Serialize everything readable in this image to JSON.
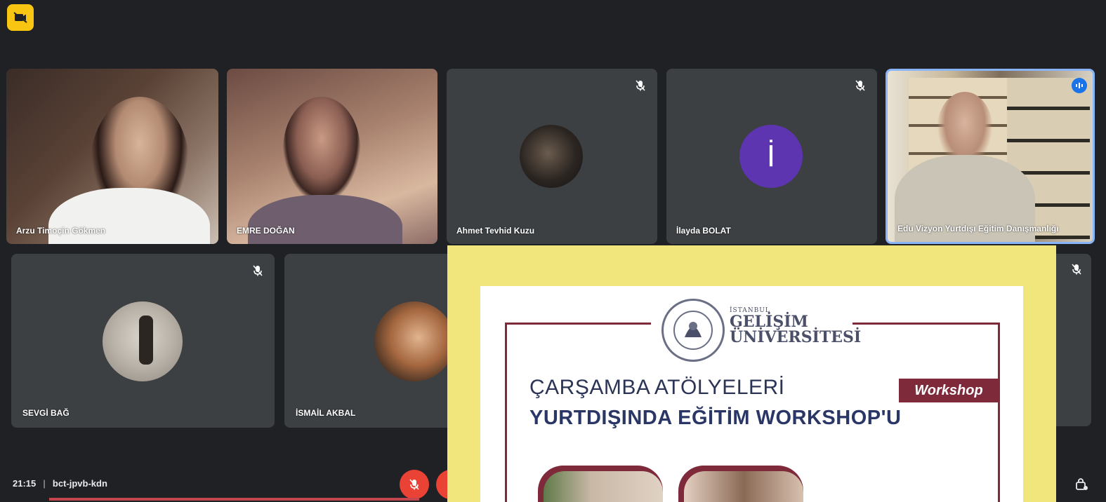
{
  "top": {
    "camera_badge_icon": "camera-off-icon",
    "badge_color": "#f9c513"
  },
  "participants_row1": [
    {
      "name": "Arzu Timoçin Gökmen",
      "type": "video",
      "muted": false
    },
    {
      "name": "EMRE DOĞAN",
      "type": "video",
      "muted": false
    },
    {
      "name": "Ahmet Tevhid Kuzu",
      "type": "avatar-photo",
      "muted": true
    },
    {
      "name": "İlayda BOLAT",
      "type": "avatar-letter",
      "letter": "İ",
      "avatar_color": "#5e35b1",
      "muted": true
    },
    {
      "name": "Edu Vizyon Yurtdışı Eğitim Danışmanlığı",
      "type": "video",
      "muted": false,
      "speaking": true
    }
  ],
  "participants_row2": [
    {
      "name": "SEVGİ BAĞ",
      "type": "avatar-photo",
      "muted": true
    },
    {
      "name": "İSMAİL AKBAL",
      "type": "avatar-photo",
      "muted": true
    }
  ],
  "bottom": {
    "time": "21:15",
    "meeting_code": "bct-jpvb-kdn"
  },
  "poster": {
    "university_small": "İSTANBUL",
    "university_line1": "GELİŞİM",
    "university_line2": "ÜNİVERSİTESİ",
    "badge": "Workshop",
    "title_line1": "ÇARŞAMBA ATÖLYELERİ",
    "title_line2": "YURTDIŞINDA EĞİTİM WORKSHOP'U",
    "accent_color": "#7e2a3a",
    "background_color": "#f0e67c"
  }
}
